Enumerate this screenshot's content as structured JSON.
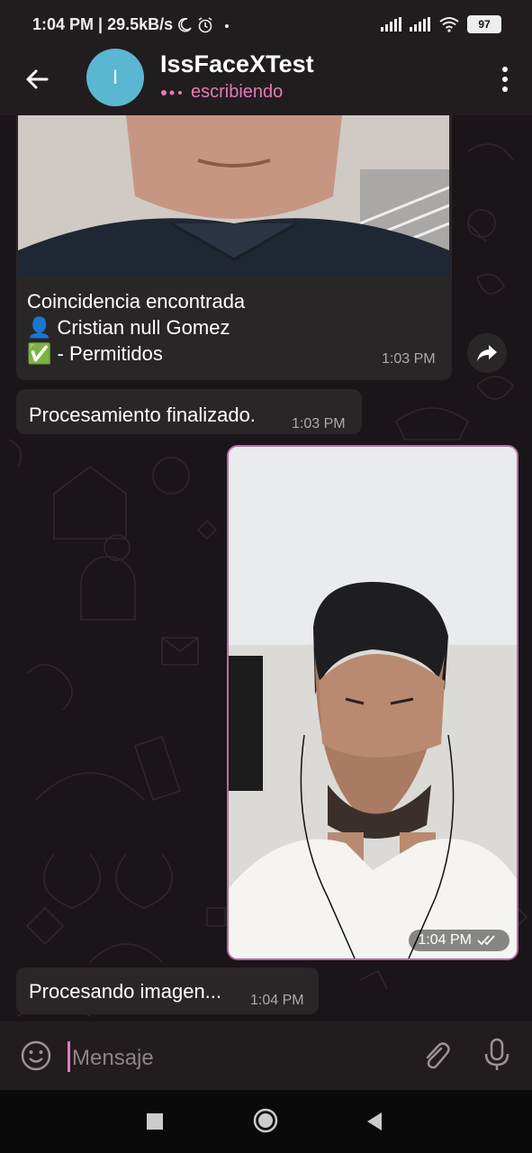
{
  "status_bar": {
    "time_speed": "1:04 PM | 29.5kB/s",
    "battery": "97",
    "icons": [
      "moon-icon",
      "alarm-icon",
      "dot-icon",
      "signal-icon",
      "signal-icon",
      "wifi-icon",
      "battery-icon"
    ]
  },
  "header": {
    "avatar_letter": "I",
    "title": "IssFaceXTest",
    "status": "escribiendo",
    "accent_color": "#e67ab5",
    "avatar_color": "#5bb6d2"
  },
  "messages": [
    {
      "type": "incoming-photo",
      "line1": "Coincidencia encontrada",
      "line2": "👤 Cristian null Gomez",
      "line3": "✅ - Permitidos",
      "time": "1:03 PM"
    },
    {
      "type": "incoming-text",
      "text": "Procesamiento finalizado.",
      "time": "1:03 PM"
    },
    {
      "type": "outgoing-photo",
      "time": "1:04 PM"
    },
    {
      "type": "incoming-text",
      "text": "Procesando imagen...",
      "time": "1:04 PM"
    }
  ],
  "input": {
    "placeholder": "Mensaje"
  }
}
